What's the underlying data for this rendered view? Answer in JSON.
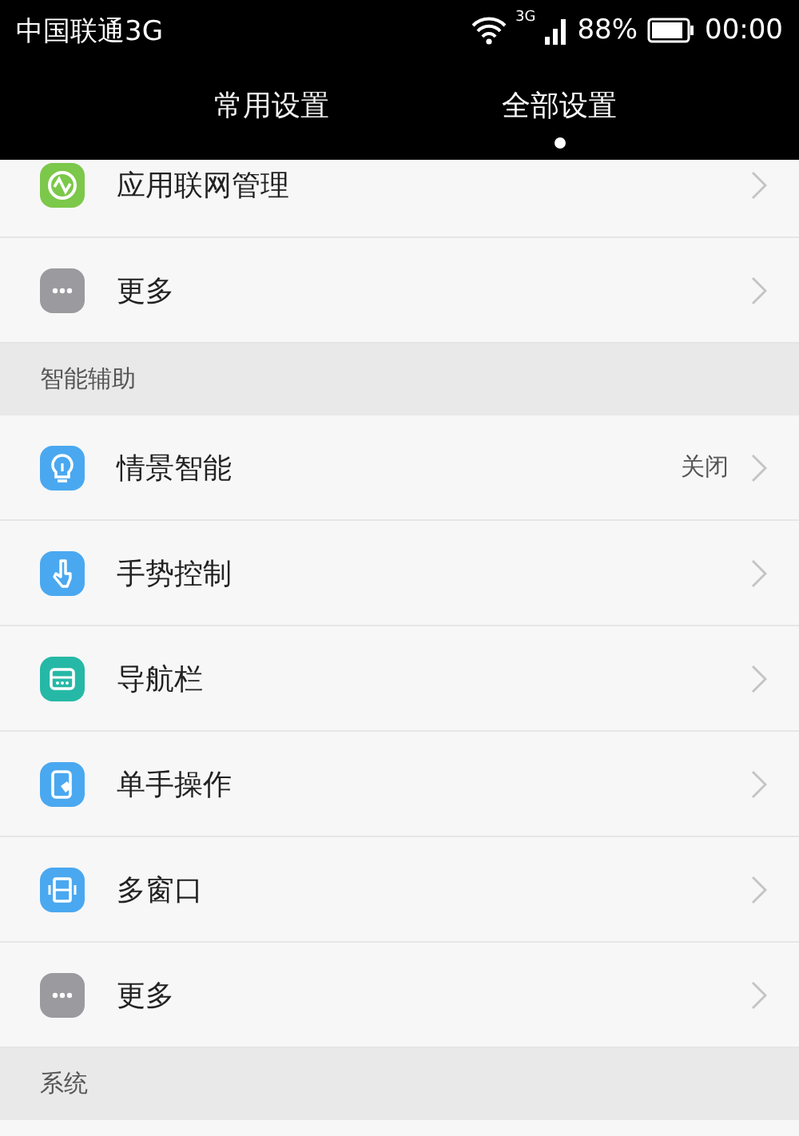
{
  "status_bar": {
    "carrier": "中国联通3G",
    "network": "3G",
    "battery": "88%",
    "time": "00:00"
  },
  "tabs": [
    {
      "label": "常用设置",
      "selected": false
    },
    {
      "label": "全部设置",
      "selected": true
    }
  ],
  "sections": [
    {
      "items": [
        {
          "kind": "network",
          "label": "应用联网管理"
        },
        {
          "kind": "more",
          "label": "更多"
        }
      ]
    },
    {
      "title": "智能辅助",
      "items": [
        {
          "kind": "bulb",
          "label": "情景智能",
          "value": "关闭"
        },
        {
          "kind": "gesture",
          "label": "手势控制"
        },
        {
          "kind": "navbar",
          "label": "导航栏"
        },
        {
          "kind": "onehand",
          "label": "单手操作"
        },
        {
          "kind": "multiwindow",
          "label": "多窗口"
        },
        {
          "kind": "more",
          "label": "更多"
        }
      ]
    },
    {
      "title": "系统"
    }
  ]
}
